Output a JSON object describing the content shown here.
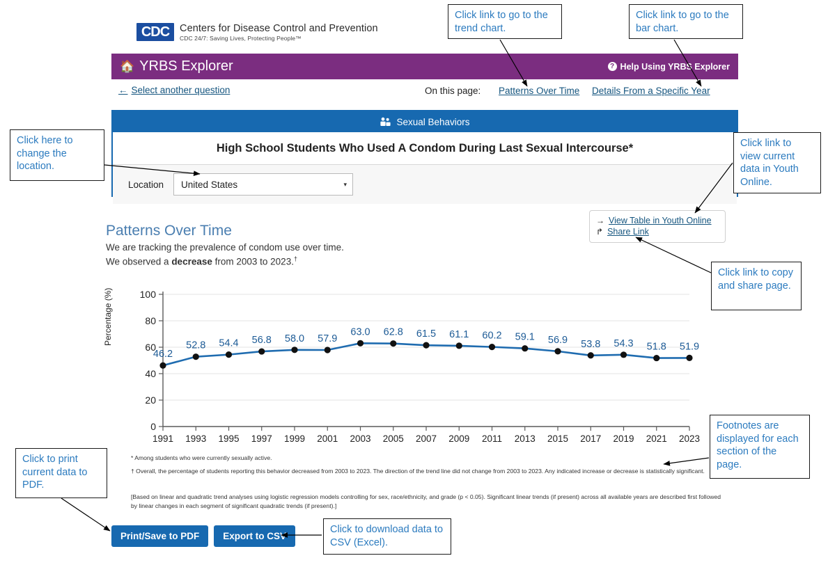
{
  "cdc": {
    "logo_text": "CDC",
    "agency": "Centers for Disease Control and Prevention",
    "tagline": "CDC 24/7: Saving Lives, Protecting People™"
  },
  "header": {
    "home_icon": "home-icon",
    "title": "YRBS Explorer",
    "help_icon": "question-mark-icon",
    "help_label": "Help Using YRBS Explorer",
    "background": "#7b2d80"
  },
  "subnav": {
    "back_arrow": "←",
    "back_label": "Select another question",
    "on_this_page_label": "On this page:",
    "links": [
      {
        "label": "Patterns Over Time"
      },
      {
        "label": "Details From a Specific Year"
      }
    ]
  },
  "panel": {
    "category_icon": "people-icon",
    "category": "Sexual Behaviors",
    "question": "High School Students Who Used A Condom During Last Sexual Intercourse*",
    "location_label": "Location",
    "location_value": "United States",
    "location_caret": "▾",
    "accent": "#1769b0"
  },
  "linkbox": {
    "items": [
      {
        "icon": "right-arrow-icon",
        "glyph": "→",
        "label": "View Table in Youth Online"
      },
      {
        "icon": "share-icon",
        "glyph": "↱",
        "label": "Share Link"
      }
    ]
  },
  "section": {
    "title": "Patterns Over Time",
    "line1": "We are tracking the prevalence of condom use over time.",
    "line2_pre": "We observed a ",
    "line2_bold": "decrease",
    "line2_post": " from 2003 to 2023.",
    "line2_dagger": "†"
  },
  "chart_data": {
    "type": "line",
    "title": "",
    "xlabel": "",
    "ylabel": "Percentage (%)",
    "ylim": [
      0,
      100
    ],
    "yticks": [
      0,
      20,
      40,
      60,
      80,
      100
    ],
    "grid": true,
    "legend": "none",
    "line_color": "#1f6cb0",
    "marker_color": "#111111",
    "label_color": "#1d5b96",
    "categories": [
      "1991",
      "1993",
      "1995",
      "1997",
      "1999",
      "2001",
      "2003",
      "2005",
      "2007",
      "2009",
      "2011",
      "2013",
      "2015",
      "2017",
      "2019",
      "2021",
      "2023"
    ],
    "values": [
      46.2,
      52.8,
      54.4,
      56.8,
      58.0,
      57.9,
      63.0,
      62.8,
      61.5,
      61.1,
      60.2,
      59.1,
      56.9,
      53.8,
      54.3,
      51.8,
      51.9
    ],
    "data_labels": [
      "46.2",
      "52.8",
      "54.4",
      "56.8",
      "58.0",
      "57.9",
      "63.0",
      "62.8",
      "61.5",
      "61.1",
      "60.2",
      "59.1",
      "56.9",
      "53.8",
      "54.3",
      "51.8",
      "51.9"
    ]
  },
  "footnotes": {
    "n1": "* Among students who were currently sexually active.",
    "n2": "† Overall, the percentage of students reporting this behavior decreased from 2003 to 2023. The direction of the trend line did not change from 2003 to 2023. Any indicated increase or decrease is statistically significant.",
    "n3": "[Based on linear and quadratic trend analyses using logistic regression models controlling for sex, race/ethnicity, and grade (p < 0.05). Significant linear trends (if present) across all available years are described first followed by linear changes in each segment of significant quadratic trends (if present).]"
  },
  "buttons": {
    "print": "Print/Save to PDF",
    "export": "Export to CSV"
  },
  "callouts": {
    "trend": "Click link to go to the trend chart.",
    "bar": "Click link to go to the bar chart.",
    "location": "Click here to change the location.",
    "youth_online": "Click link to view current data in Youth Online.",
    "share": "Click link to copy and share page.",
    "footnotes": "Footnotes are displayed for each section of the page.",
    "print": "Click to print current data to PDF.",
    "csv": "Click to download data to CSV (Excel).",
    "text_color": "#2c7bbf"
  }
}
